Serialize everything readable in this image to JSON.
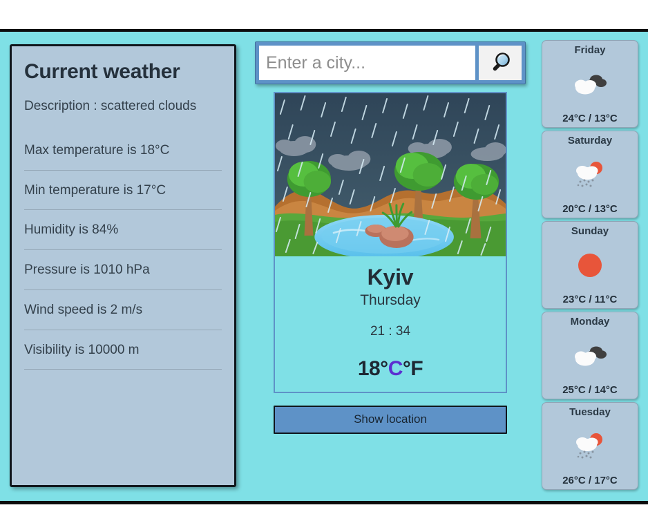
{
  "current": {
    "title": "Current weather",
    "description": "Description : scattered clouds",
    "details": [
      "Max temperature is 18°C",
      "Min temperature is 17°C",
      "Humidity is 84%",
      "Pressure is 1010 hPa",
      "Wind speed is 2 m/s",
      "Visibility is 10000 m"
    ]
  },
  "search": {
    "placeholder": "Enter a city...",
    "value": "",
    "icon": "search-icon"
  },
  "card": {
    "image_alt": "rainy-landscape-illustration",
    "city": "Kyiv",
    "day": "Thursday",
    "time": "21 : 34",
    "temperature": "18°",
    "unit_celsius": "C",
    "unit_fahrenheit": "°F",
    "active_unit": "C",
    "active_unit_color": "#5b2fd0"
  },
  "actions": {
    "show_location": "Show location"
  },
  "forecast": [
    {
      "day": "Friday",
      "icon": "broken-clouds-icon",
      "temps": "24°C / 13°C",
      "high": "24°C",
      "low": "13°C"
    },
    {
      "day": "Saturday",
      "icon": "sun-rain-icon",
      "temps": "20°C / 13°C",
      "high": "20°C",
      "low": "13°C"
    },
    {
      "day": "Sunday",
      "icon": "clear-sun-icon",
      "temps": "23°C / 11°C",
      "high": "23°C",
      "low": "11°C"
    },
    {
      "day": "Monday",
      "icon": "broken-clouds-icon",
      "temps": "25°C / 14°C",
      "high": "25°C",
      "low": "14°C"
    },
    {
      "day": "Tuesday",
      "icon": "sun-rain-icon",
      "temps": "26°C / 17°C",
      "high": "26°C",
      "low": "17°C"
    }
  ],
  "colors": {
    "app_background": "#7fe0e6",
    "panel_background": "#b2c8da",
    "accent_blue": "#5e92c7",
    "sun_orange": "#e8553a",
    "cloud_dark": "#3f3f3f",
    "text_dark": "#25313c"
  }
}
